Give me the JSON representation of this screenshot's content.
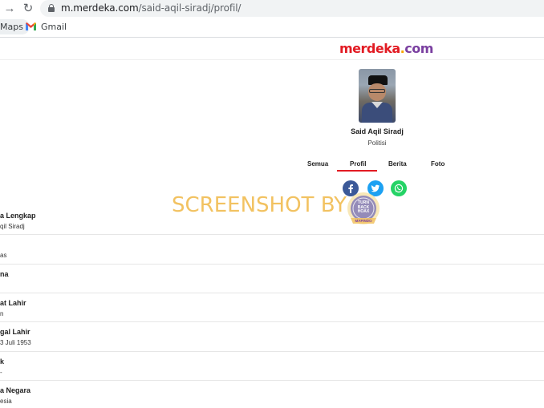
{
  "browser": {
    "url_host": "m.merdeka.com",
    "url_path": "/said-aqil-siradj/profil/",
    "bookmarks": [
      {
        "label": "Maps"
      },
      {
        "label": "Gmail"
      }
    ]
  },
  "site": {
    "logo_parts": [
      "merdeka",
      ".",
      "com"
    ]
  },
  "profile": {
    "name": "Said Aqil Siradj",
    "role": "Politisi"
  },
  "tabs": [
    {
      "label": "Semua"
    },
    {
      "label": "Profil",
      "active": true
    },
    {
      "label": "Berita"
    },
    {
      "label": "Foto"
    }
  ],
  "share_icons": [
    "facebook-icon",
    "twitter-icon",
    "whatsapp-icon"
  ],
  "watermark": {
    "text": "SCREENSHOT BY",
    "badge_text": [
      "TURN",
      "BACK",
      "HOAX",
      "MAFINDO"
    ]
  },
  "details": [
    {
      "label": "a Lengkap",
      "value": "qil Siradj"
    },
    {
      "label": "",
      "value": "as"
    },
    {
      "label": "na",
      "value": ""
    },
    {
      "label": "at Lahir",
      "value": "n"
    },
    {
      "label": "gal Lahir",
      "value": "3 Juli 1953"
    },
    {
      "label": "k",
      "value": "-"
    },
    {
      "label": "a Negara",
      "value": "esia"
    }
  ],
  "colors": {
    "accent": "#e21b23",
    "watermark": "#f2c261",
    "facebook": "#3b5998",
    "twitter": "#1da1f2",
    "whatsapp": "#25d366"
  }
}
